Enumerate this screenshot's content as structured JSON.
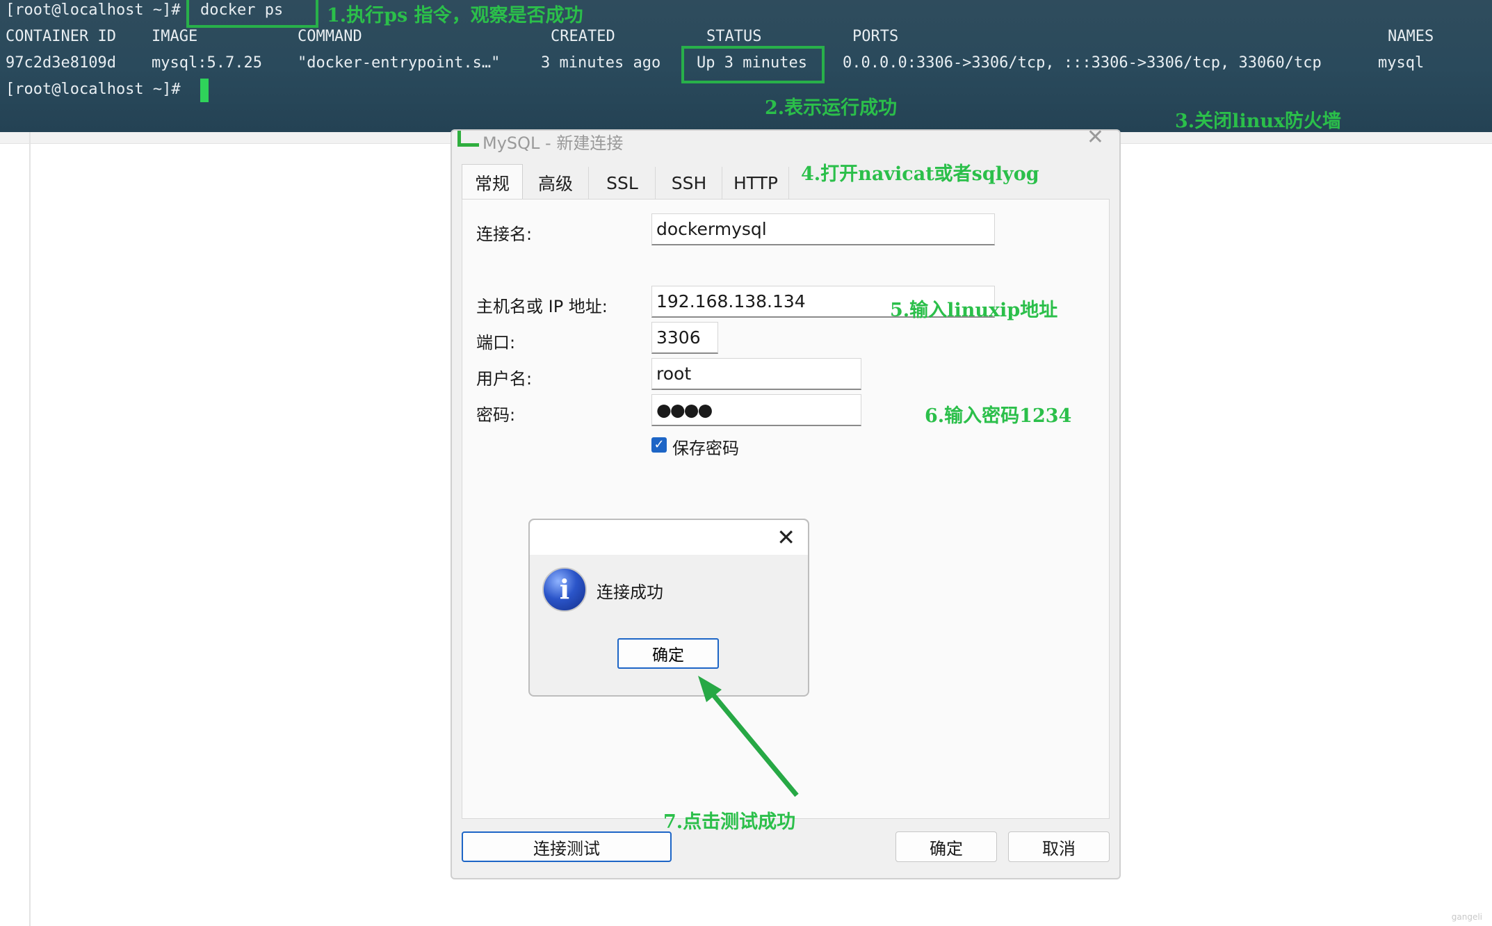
{
  "terminal": {
    "prompt1": "[root@localhost ~]#",
    "command": "docker ps",
    "headers": {
      "container_id": "CONTAINER ID",
      "image": "IMAGE",
      "command": "COMMAND",
      "created": "CREATED",
      "status": "STATUS",
      "ports": "PORTS",
      "names": "NAMES"
    },
    "row": {
      "container_id": "97c2d3e8109d",
      "image": "mysql:5.7.25",
      "command": "\"docker-entrypoint.s…\"",
      "created": "3 minutes ago",
      "status": "Up 3 minutes",
      "ports": "0.0.0.0:3306->3306/tcp, :::3306->3306/tcp, 33060/tcp",
      "names": "mysql"
    },
    "prompt2": "[root@localhost ~]#"
  },
  "annotations": {
    "step1": "1.执行ps 指令，观察是否成功",
    "step2": "2.表示运行成功",
    "step3": "3.关闭linux防火墙",
    "step4": "4.打开navicat或者sqlyog",
    "step5": "5.输入linuxip地址",
    "step6": "6.输入密码1234",
    "step7": "7.点击测试成功"
  },
  "dialog": {
    "title": "MySQL - 新建连接",
    "tabs": [
      "常规",
      "高级",
      "SSL",
      "SSH",
      "HTTP"
    ],
    "labels": {
      "conn_name": "连接名:",
      "host": "主机名或 IP 地址:",
      "port": "端口:",
      "user": "用户名:",
      "password": "密码:"
    },
    "values": {
      "conn_name": "dockermysql",
      "host": "192.168.138.134",
      "port": "3306",
      "user": "root",
      "password": "●●●●"
    },
    "save_password": "保存密码",
    "buttons": {
      "test": "连接测试",
      "ok": "确定",
      "cancel": "取消"
    }
  },
  "message_box": {
    "text": "连接成功",
    "ok": "确定"
  },
  "watermark": "gangeli",
  "colors": {
    "annotation_green": "#2bbf4a",
    "accent_blue": "#1d65c6",
    "terminal_bg": "#2a4a5c"
  }
}
